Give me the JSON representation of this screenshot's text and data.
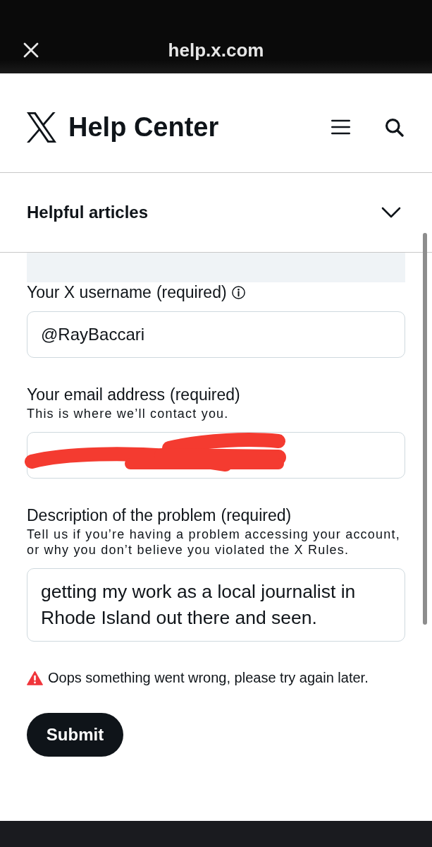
{
  "browser": {
    "url": "help.x.com"
  },
  "header": {
    "title": "Help Center"
  },
  "helpful_articles": {
    "label": "Helpful articles",
    "expanded": false
  },
  "form": {
    "fields": [
      {
        "kind": "input",
        "label": "Your X username",
        "required_note": "(required)",
        "info": true,
        "value": "@RayBaccari"
      },
      {
        "kind": "input",
        "label": "Your email address",
        "required_note": "(required)",
        "hint": "This is where we’ll contact you.",
        "redacted": true
      },
      {
        "kind": "textarea",
        "label": "Description of the problem",
        "required_note": "(required)",
        "hint": "Tell us if you’re having a problem accessing your account, or why you don’t believe you violated the X Rules.",
        "value": "getting my work as a local journalist in\nRhode Island out there and seen."
      }
    ],
    "error": "Oops something went wrong, please try again later.",
    "submit": "Submit"
  }
}
